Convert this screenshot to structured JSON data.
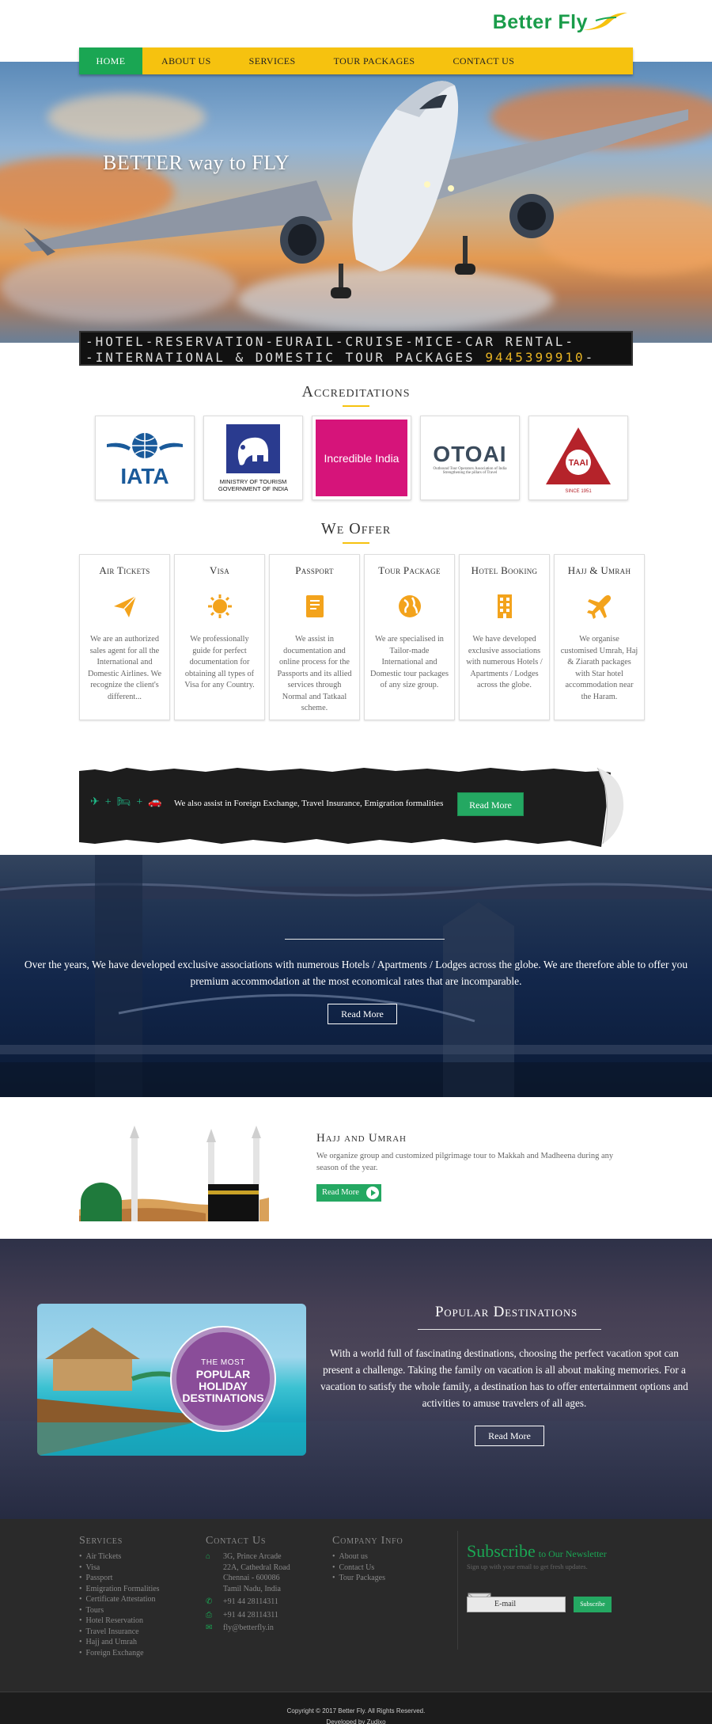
{
  "logo": {
    "text": "Better Fly"
  },
  "nav": {
    "items": [
      {
        "label": "Home",
        "active": true
      },
      {
        "label": "About Us"
      },
      {
        "label": "Services"
      },
      {
        "label": "Tour Packages"
      },
      {
        "label": "Contact Us"
      }
    ]
  },
  "hero": {
    "title": "BETTER way to FLY",
    "ticker_line1": "-HOTEL-RESERVATION-EURAIL-CRUISE-MICE-CAR RENTAL-",
    "ticker_line2": "-INTERNATIONAL & DOMESTIC TOUR PACKAGES",
    "ticker_phone": "9445399910"
  },
  "accreditations": {
    "title": "Accreditations",
    "logos": [
      {
        "name": "IATA"
      },
      {
        "name": "MINISTRY OF TOURISM GOVERNMENT OF INDIA"
      },
      {
        "name": "Incredible India"
      },
      {
        "name": "OTOAI",
        "tagline": "Outbound Tour Operators Association of India",
        "tagline2": "Strengthening the pillars of Travel"
      },
      {
        "name": "TAAI",
        "tagline": "SINCE 1951"
      }
    ]
  },
  "offer": {
    "title": "We Offer",
    "cards": [
      {
        "title": "Air Tickets",
        "icon": "paper-plane-icon",
        "desc": "We are an authorized sales agent for all the International and Domestic Airlines. We recognize the client's different..."
      },
      {
        "title": "Visa",
        "icon": "sun-icon",
        "desc": "We professionally guide for perfect documentation for obtaining all types of Visa for any Country."
      },
      {
        "title": "Passport",
        "icon": "book-icon",
        "desc": "We assist in documentation and online process for the Passports and its allied services through Normal and Tatkaal scheme."
      },
      {
        "title": "Tour Package",
        "icon": "globe-icon",
        "desc": "We are specialised in Tailor-made International and Domestic tour packages of any size group."
      },
      {
        "title": "Hotel Booking",
        "icon": "building-icon",
        "desc": "We have developed exclusive associations with numerous Hotels / Apartments / Lodges across the globe."
      },
      {
        "title": "Hajj & Umrah",
        "icon": "plane-icon",
        "desc": "We organise customised Umrah, Haj & Ziarath packages with Star hotel accommodation near the Haram."
      }
    ]
  },
  "banner": {
    "text": "We also assist in Foreign Exchange, Travel Insurance, Emigration formalities",
    "button": "Read More"
  },
  "hotels": {
    "text": "Over the years, We have developed exclusive associations with numerous Hotels / Apartments / Lodges across the globe. We are therefore able to offer you premium accommodation at the most economical rates that are incomparable.",
    "button": "Read More"
  },
  "hajj": {
    "title": "Hajj and Umrah",
    "desc": "We organize group and customized pilgrimage tour to Makkah and Madheena during any season of the year.",
    "button": "Read More"
  },
  "popular": {
    "title": "Popular Destinations",
    "badge_small": "THE MOST",
    "badge_big": "POPULAR HOLIDAY DESTINATIONS",
    "text": "With a world full of fascinating destinations, choosing the perfect vacation spot can present a challenge. Taking the family on vacation is all about making memories. For a vacation to satisfy the whole family, a destination has to offer entertainment options and activities to amuse travelers of all ages.",
    "button": "Read More"
  },
  "footer": {
    "services_title": "Services",
    "services": [
      "Air Tickets",
      "Visa",
      "Passport",
      "Emigration Formalities",
      "Certificate Attestation",
      "Tours",
      "Hotel Reservation",
      "Travel Insurance",
      "Hajj and Umrah",
      "Foreign Exchange"
    ],
    "contact_title": "Contact Us",
    "address": [
      "3G, Prince Arcade",
      "22A, Cathedral Road",
      "Chennai - 600086",
      "Tamil Nadu, India"
    ],
    "phone": "+91 44 28114311",
    "fax": "+91 44 28114311",
    "email": "fly@betterfly.in",
    "company_title": "Company Info",
    "company": [
      "About us",
      "Contact Us",
      "Tour Packages"
    ],
    "subscribe_big": "Subscribe",
    "subscribe_small": "to Our Newsletter",
    "subscribe_desc": "Sign up with your email to get fresh updates.",
    "email_placeholder": "E-mail",
    "subscribe_button": "Subscribe"
  },
  "copyright": {
    "line1": "Copyright © 2017 Better Fly. All Rights Reserved.",
    "line2": "Developed by Zudixo"
  },
  "colors": {
    "green": "#1aa653",
    "yellow": "#f6c20f",
    "dark": "#2a2a2a"
  }
}
